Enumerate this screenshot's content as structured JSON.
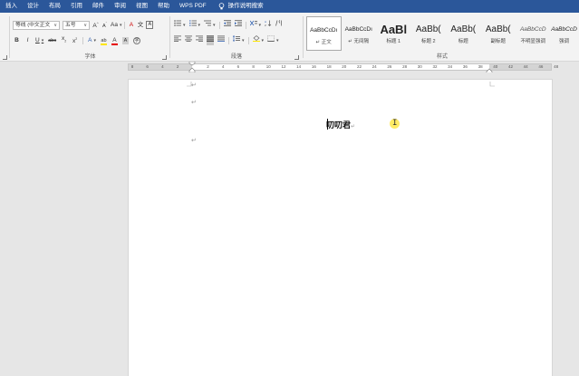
{
  "menu": {
    "items": [
      "插入",
      "设计",
      "布局",
      "引用",
      "邮件",
      "审阅",
      "视图",
      "帮助",
      "WPS PDF"
    ],
    "search_label": "操作说明搜索"
  },
  "font_group": {
    "label": "字体",
    "font_name": "等线 (中文正文",
    "font_size": "五号",
    "grow": "A",
    "shrink": "A",
    "case": "Aa",
    "clear": "A",
    "phonetic": "文",
    "border_char": "A",
    "bold": "B",
    "italic": "I",
    "underline": "U",
    "strike": "abc",
    "subscript": "x",
    "superscript": "x",
    "text_effect": "A",
    "highlight": "ab",
    "font_color": "A",
    "char_shading": "A",
    "enclose": "字"
  },
  "paragraph_group": {
    "label": "段落"
  },
  "styles_group": {
    "label": "样式",
    "items": [
      {
        "preview": "AaBbCcDı",
        "name": "↵ 正文"
      },
      {
        "preview": "AaBbCcDı",
        "name": "↵ 无间隔"
      },
      {
        "preview": "AaBl",
        "name": "标题 1"
      },
      {
        "preview": "AaBb(",
        "name": "标题 2"
      },
      {
        "preview": "AaBb(",
        "name": "标题"
      },
      {
        "preview": "AaBb(",
        "name": "副标题"
      },
      {
        "preview": "AaBbCcD",
        "name": "不明显强调"
      },
      {
        "preview": "AaBbCcD",
        "name": "强调"
      }
    ]
  },
  "ruler": {
    "numbers": [
      "8",
      "6",
      "4",
      "2",
      "",
      "2",
      "4",
      "6",
      "8",
      "10",
      "12",
      "14",
      "16",
      "18",
      "20",
      "22",
      "24",
      "26",
      "28",
      "30",
      "32",
      "34",
      "36",
      "38",
      "40",
      "42",
      "44",
      "46",
      "48"
    ]
  },
  "document": {
    "text": "叨叨君",
    "para_mark": "↵"
  },
  "colors": {
    "menu_bg": "#2b579a",
    "highlight": "#ffe600",
    "font_color": "#e60000",
    "cursor_glow": "#ffe84a"
  }
}
